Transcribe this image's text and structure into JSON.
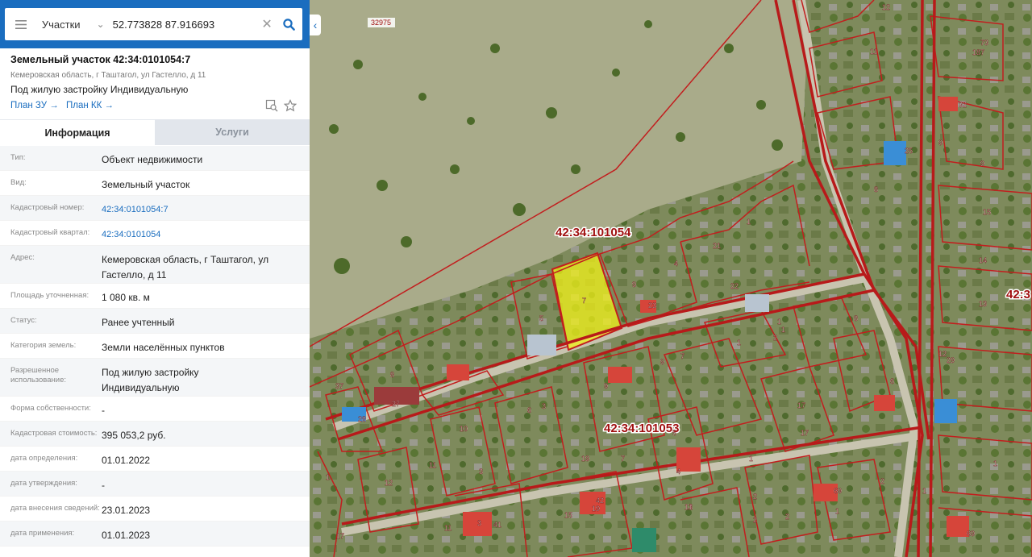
{
  "search": {
    "layer": "Участки",
    "query": "52.773828 87.916693"
  },
  "object": {
    "title": "Земельный участок 42:34:0101054:7",
    "address": "Кемеровская область, г Таштагол, ул Гастелло, д 11",
    "purpose": "Под жилую застройку Индивидуальную",
    "plan_zu": "План ЗУ →",
    "plan_kk": "План КК →"
  },
  "tabs": {
    "info": "Информация",
    "services": "Услуги"
  },
  "fields": [
    {
      "label": "Тип:",
      "value": "Объект недвижимости"
    },
    {
      "label": "Вид:",
      "value": "Земельный участок"
    },
    {
      "label": "Кадастровый номер:",
      "value": "42:34:0101054:7"
    },
    {
      "label": "Кадастровый квартал:",
      "value": "42:34:0101054"
    },
    {
      "label": "Адрес:",
      "value": "Кемеровская область, г Таштагол, ул Гастелло, д 11"
    },
    {
      "label": "Площадь уточненная:",
      "value": "1 080 кв. м"
    },
    {
      "label": "Статус:",
      "value": "Ранее учтенный"
    },
    {
      "label": "Категория земель:",
      "value": "Земли населённых пунктов"
    },
    {
      "label": "Разрешенное использование:",
      "value": "Под жилую застройку Индивидуальную"
    },
    {
      "label": "Форма собственности:",
      "value": "-"
    },
    {
      "label": "Кадастровая стоимость:",
      "value": "395 053,2 руб."
    },
    {
      "label": "дата определения:",
      "value": "01.01.2022"
    },
    {
      "label": "дата утверждения:",
      "value": "-"
    },
    {
      "label": "дата внесения сведений:",
      "value": "23.01.2023"
    },
    {
      "label": "дата применения:",
      "value": "01.01.2023"
    }
  ],
  "map": {
    "quarter_1": "42:34:101054",
    "quarter_2": "42:34:101053",
    "quarter_3": "42:3",
    "road_number": "32975",
    "plot_labels": [
      "7",
      "9",
      "23",
      "22",
      "21",
      "1",
      "4",
      "1",
      "5",
      "8",
      "12",
      "11",
      "73",
      "187",
      "32",
      "9",
      "25",
      "9",
      "8",
      "15",
      "14",
      "13",
      "12",
      "29",
      "6",
      "1",
      "1",
      "8",
      "17",
      "1",
      "27",
      "37",
      "28",
      "10",
      "11",
      "3",
      "12",
      "11",
      "5",
      "9",
      "6",
      "19",
      "7",
      "3",
      "15",
      "19",
      "42",
      "2",
      "2",
      "2",
      "17",
      "1",
      "2",
      "69",
      "1",
      "69",
      "17",
      "4",
      "3",
      "41",
      "1",
      "9",
      "7",
      "13",
      "1",
      "2",
      "1"
    ],
    "colors": {
      "boundary": "#c21e1e",
      "selected_fill": "#f2f21a",
      "road": "#b81a1a"
    }
  }
}
